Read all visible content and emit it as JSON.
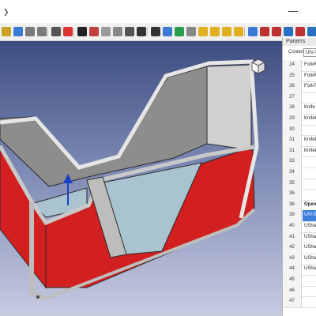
{
  "colors": {
    "viewport_top": "#3d4d80",
    "viewport_bottom": "#c7cbe0",
    "part_red": "#d21f1f",
    "part_grey": "#b8b8b8",
    "inner_blue": "#a9c4d0",
    "selection_blue": "#3d7fe0"
  },
  "toolbar": {
    "icons": [
      "open-icon",
      "save-icon",
      "undo-icon",
      "redo-icon",
      "dropdown-icon",
      "axis-icon",
      "cut-icon",
      "refresh-icon",
      "box-icon",
      "cube-icon",
      "dropdown-icon",
      "point-icon",
      "line-icon",
      "workplane-icon",
      "measure-icon",
      "settings-icon",
      "part-icon",
      "part-icon",
      "part-icon",
      "part-icon",
      "view-icon",
      "mirror-icon",
      "part-icon",
      "part-icon",
      "part-icon",
      "part-icon"
    ]
  },
  "panel": {
    "title": "Params",
    "content_label": "Content:",
    "content_value": "U/V-Shape",
    "rows": [
      {
        "num": "24",
        "text": "ForkR",
        "style": ""
      },
      {
        "num": "25",
        "text": "ForkR",
        "style": ""
      },
      {
        "num": "26",
        "text": "ForkTo",
        "style": ""
      },
      {
        "num": "27",
        "text": "",
        "style": ""
      },
      {
        "num": "28",
        "text": "Knife C",
        "style": ""
      },
      {
        "num": "29",
        "text": "KnifeC",
        "style": ""
      },
      {
        "num": "30",
        "text": "",
        "style": ""
      },
      {
        "num": "31",
        "text": "KnifeN",
        "style": ""
      },
      {
        "num": "31",
        "text": "KnifeL",
        "style": ""
      },
      {
        "num": "33",
        "text": "",
        "style": ""
      },
      {
        "num": "34",
        "text": "",
        "style": ""
      },
      {
        "num": "35",
        "text": "",
        "style": ""
      },
      {
        "num": "36",
        "text": "",
        "style": ""
      },
      {
        "num": "38",
        "text": "Open",
        "style": "bold"
      },
      {
        "num": "39",
        "text": "U/V-S",
        "style": "sel"
      },
      {
        "num": "40",
        "text": "UShap",
        "style": ""
      },
      {
        "num": "41",
        "text": "UShap",
        "style": ""
      },
      {
        "num": "42",
        "text": "UShap",
        "style": ""
      },
      {
        "num": "43",
        "text": "UShap",
        "style": ""
      },
      {
        "num": "44",
        "text": "UShap",
        "style": ""
      },
      {
        "num": "45",
        "text": "",
        "style": ""
      },
      {
        "num": "46",
        "text": "",
        "style": ""
      },
      {
        "num": "47",
        "text": "",
        "style": ""
      }
    ]
  }
}
